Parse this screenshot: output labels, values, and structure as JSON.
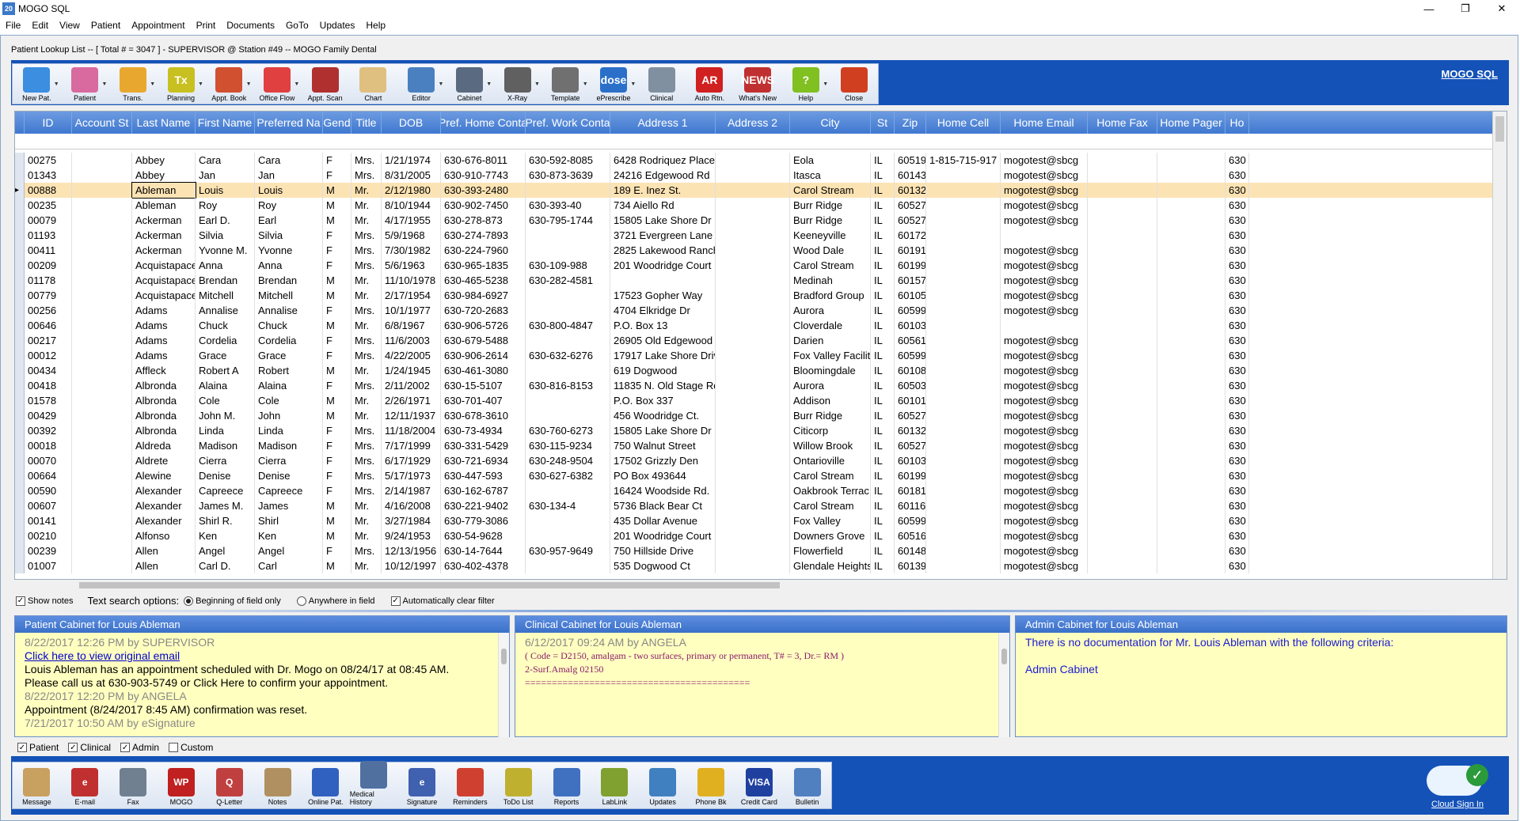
{
  "window": {
    "title": "MOGO SQL",
    "app_icon_text": "20",
    "minimize": "—",
    "maximize": "❐",
    "close": "✕"
  },
  "menu": [
    "File",
    "Edit",
    "View",
    "Patient",
    "Appointment",
    "Print",
    "Documents",
    "GoTo",
    "Updates",
    "Help"
  ],
  "subtitle": "Patient Lookup List -- [ Total # = 3047 ] - SUPERVISOR @ Station #49 -- MOGO Family Dental",
  "mogo_link": "MOGO SQL",
  "toolbar": [
    {
      "label": "New Pat.",
      "icon": "new-patient-icon",
      "color": "#3b8ee0"
    },
    {
      "label": "Patient",
      "icon": "patient-icon",
      "color": "#d86aa0"
    },
    {
      "label": "Trans.",
      "icon": "folder-icon",
      "color": "#e8a830"
    },
    {
      "label": "Planning",
      "icon": "tx-planning-icon",
      "color": "#c8c020",
      "text": "Tx"
    },
    {
      "label": "Appt. Book",
      "icon": "appointment-book-icon",
      "color": "#d05030"
    },
    {
      "label": "Office Flow",
      "icon": "office-flow-icon",
      "color": "#e04040"
    },
    {
      "label": "Appt. Scan",
      "icon": "appointment-scan-icon",
      "color": "#b03030"
    },
    {
      "label": "Chart",
      "icon": "tooth-chart-icon",
      "color": "#e0c080"
    },
    {
      "label": "Editor",
      "icon": "image-editor-icon",
      "color": "#4a80c0"
    },
    {
      "label": "Cabinet",
      "icon": "cabinet-icon",
      "color": "#5a6a80"
    },
    {
      "label": "X-Ray",
      "icon": "xray-icon",
      "color": "#606060"
    },
    {
      "label": "Template",
      "icon": "template-icon",
      "color": "#707070"
    },
    {
      "label": "ePrescribe",
      "icon": "dosespot-icon",
      "color": "#2a70c8",
      "text": "dose"
    },
    {
      "label": "Clinical",
      "icon": "clinical-icon",
      "color": "#8090a0"
    },
    {
      "label": "Auto Rtn.",
      "icon": "auto-return-icon",
      "color": "#d02020",
      "text": "AR"
    },
    {
      "label": "What's New",
      "icon": "news-icon",
      "color": "#c03030",
      "text": "NEWS"
    },
    {
      "label": "Help",
      "icon": "help-icon",
      "color": "#80c020",
      "text": "?"
    },
    {
      "label": "Close",
      "icon": "close-door-icon",
      "color": "#d04020"
    }
  ],
  "grid": {
    "columns": [
      "ID",
      "Account St",
      "Last Name",
      "First Name",
      "Preferred Na",
      "Gend",
      "Title",
      "DOB",
      "Pref. Home Conta",
      "Pref. Work Conta",
      "Address 1",
      "Address 2",
      "City",
      "St",
      "Zip",
      "Home Cell",
      "Home Email",
      "Home Fax",
      "Home Pager",
      "Ho"
    ],
    "rows": [
      [
        "00275",
        "",
        "Abbey",
        "Cara",
        "Cara",
        "F",
        "Mrs.",
        "1/21/1974",
        "630-676-8011",
        "630-592-8085",
        "6428 Rodriquez Place",
        "",
        "Eola",
        "IL",
        "60519",
        "1-815-715-917",
        "mogotest@sbcg",
        "",
        "",
        "630"
      ],
      [
        "01343",
        "",
        "Abbey",
        "Jan",
        "Jan",
        "F",
        "Mrs.",
        "8/31/2005",
        "630-910-7743",
        "630-873-3639",
        "24216 Edgewood Rd",
        "",
        "Itasca",
        "IL",
        "60143",
        "",
        "mogotest@sbcg",
        "",
        "",
        "630"
      ],
      [
        "00888",
        "",
        "Ableman",
        "Louis",
        "Louis",
        "M",
        "Mr.",
        "2/12/1980",
        "630-393-2480",
        "",
        "189 E. Inez St.",
        "",
        "Carol Stream",
        "IL",
        "60132",
        "",
        "mogotest@sbcg",
        "",
        "",
        "630"
      ],
      [
        "00235",
        "",
        "Ableman",
        "Roy",
        "Roy",
        "M",
        "Mr.",
        "8/10/1944",
        "630-902-7450",
        "630-393-40",
        "734 Aiello Rd",
        "",
        "Burr Ridge",
        "IL",
        "60527",
        "",
        "mogotest@sbcg",
        "",
        "",
        "630"
      ],
      [
        "00079",
        "",
        "Ackerman",
        "Earl D.",
        "Earl",
        "M",
        "Mr.",
        "4/17/1955",
        "630-278-873",
        "630-795-1744",
        "15805 Lake Shore Dr",
        "",
        "Burr Ridge",
        "IL",
        "60527",
        "",
        "mogotest@sbcg",
        "",
        "",
        "630"
      ],
      [
        "01193",
        "",
        "Ackerman",
        "Silvia",
        "Silvia",
        "F",
        "Mrs.",
        "5/9/1968",
        "630-274-7893",
        "",
        "3721 Evergreen Lane",
        "",
        "Keeneyville",
        "IL",
        "60172",
        "",
        "",
        "",
        "",
        "630"
      ],
      [
        "00411",
        "",
        "Ackerman",
        "Yvonne M.",
        "Yvonne",
        "F",
        "Mrs.",
        "7/30/1982",
        "630-224-7960",
        "",
        "2825 Lakewood Ranch",
        "",
        "Wood Dale",
        "IL",
        "60191",
        "",
        "mogotest@sbcg",
        "",
        "",
        "630"
      ],
      [
        "00209",
        "",
        "Acquistapace",
        "Anna",
        "Anna",
        "F",
        "Mrs.",
        "5/6/1963",
        "630-965-1835",
        "630-109-988",
        "201 Woodridge Court",
        "",
        "Carol Stream",
        "IL",
        "60199",
        "",
        "mogotest@sbcg",
        "",
        "",
        "630"
      ],
      [
        "01178",
        "",
        "Acquistapace",
        "Brendan",
        "Brendan",
        "M",
        "Mr.",
        "11/10/1978",
        "630-465-5238",
        "630-282-4581",
        "",
        "",
        "Medinah",
        "IL",
        "60157",
        "",
        "mogotest@sbcg",
        "",
        "",
        "630"
      ],
      [
        "00779",
        "",
        "Acquistapace",
        "Mitchell",
        "Mitchell",
        "M",
        "Mr.",
        "2/17/1954",
        "630-984-6927",
        "",
        "17523 Gopher Way",
        "",
        "Bradford Group",
        "IL",
        "60105",
        "",
        "mogotest@sbcg",
        "",
        "",
        "630"
      ],
      [
        "00256",
        "",
        "Adams",
        "Annalise",
        "Annalise",
        "F",
        "Mrs.",
        "10/1/1977",
        "630-720-2683",
        "",
        "4704 Elkridge Dr",
        "",
        "Aurora",
        "IL",
        "60599",
        "",
        "mogotest@sbcg",
        "",
        "",
        "630"
      ],
      [
        "00646",
        "",
        "Adams",
        "Chuck",
        "Chuck",
        "M",
        "Mr.",
        "6/8/1967",
        "630-906-5726",
        "630-800-4847",
        "P.O. Box 13",
        "",
        "Cloverdale",
        "IL",
        "60103",
        "",
        "",
        "",
        "",
        "630"
      ],
      [
        "00217",
        "",
        "Adams",
        "Cordelia",
        "Cordelia",
        "F",
        "Mrs.",
        "11/6/2003",
        "630-679-5488",
        "",
        "26905 Old Edgewood R",
        "",
        "Darien",
        "IL",
        "60561",
        "",
        "mogotest@sbcg",
        "",
        "",
        "630"
      ],
      [
        "00012",
        "",
        "Adams",
        "Grace",
        "Grace",
        "F",
        "Mrs.",
        "4/22/2005",
        "630-906-2614",
        "630-632-6276",
        "17917 Lake Shore Driv",
        "",
        "Fox Valley Facilit",
        "IL",
        "60599",
        "",
        "mogotest@sbcg",
        "",
        "",
        "630"
      ],
      [
        "00434",
        "",
        "Affleck",
        "Robert A",
        "Robert",
        "M",
        "Mr.",
        "1/24/1945",
        "630-461-3080",
        "",
        "619 Dogwood",
        "",
        "Bloomingdale",
        "IL",
        "60108",
        "",
        "mogotest@sbcg",
        "",
        "",
        "630"
      ],
      [
        "00418",
        "",
        "Albronda",
        "Alaina",
        "Alaina",
        "F",
        "Mrs.",
        "2/11/2002",
        "630-15-5107",
        "630-816-8153",
        "11835 N. Old Stage Rd",
        "",
        "Aurora",
        "IL",
        "60503",
        "",
        "mogotest@sbcg",
        "",
        "",
        "630"
      ],
      [
        "01578",
        "",
        "Albronda",
        "Cole",
        "Cole",
        "M",
        "Mr.",
        "2/26/1971",
        "630-701-407",
        "",
        "P.O. Box 337",
        "",
        "Addison",
        "IL",
        "60101",
        "",
        "mogotest@sbcg",
        "",
        "",
        "630"
      ],
      [
        "00429",
        "",
        "Albronda",
        "John M.",
        "John",
        "M",
        "Mr.",
        "12/11/1937",
        "630-678-3610",
        "",
        "456 Woodridge Ct.",
        "",
        "Burr Ridge",
        "IL",
        "60527",
        "",
        "mogotest@sbcg",
        "",
        "",
        "630"
      ],
      [
        "00392",
        "",
        "Albronda",
        "Linda",
        "Linda",
        "F",
        "Mrs.",
        "11/18/2004",
        "630-73-4934",
        "630-760-6273",
        "15805 Lake Shore Dr",
        "",
        "Citicorp",
        "IL",
        "60132",
        "",
        "mogotest@sbcg",
        "",
        "",
        "630"
      ],
      [
        "00018",
        "",
        "Aldreda",
        "Madison",
        "Madison",
        "F",
        "Mrs.",
        "7/17/1999",
        "630-331-5429",
        "630-115-9234",
        "750 Walnut Street",
        "",
        "Willow Brook",
        "IL",
        "60527",
        "",
        "mogotest@sbcg",
        "",
        "",
        "630"
      ],
      [
        "00070",
        "",
        "Aldrete",
        "Cierra",
        "Cierra",
        "F",
        "Mrs.",
        "6/17/1929",
        "630-721-6934",
        "630-248-9504",
        "17502 Grizzly Den",
        "",
        "Ontarioville",
        "IL",
        "60103",
        "",
        "mogotest@sbcg",
        "",
        "",
        "630"
      ],
      [
        "00664",
        "",
        "Alewine",
        "Denise",
        "Denise",
        "F",
        "Mrs.",
        "5/17/1973",
        "630-447-593",
        "630-627-6382",
        "PO Box 493644",
        "",
        "Carol Stream",
        "IL",
        "60199",
        "",
        "mogotest@sbcg",
        "",
        "",
        "630"
      ],
      [
        "00590",
        "",
        "Alexander",
        "Capreece",
        "Capreece",
        "F",
        "Mrs.",
        "2/14/1987",
        "630-162-6787",
        "",
        "16424 Woodside Rd.",
        "",
        "Oakbrook Terrac",
        "IL",
        "60181",
        "",
        "mogotest@sbcg",
        "",
        "",
        "630"
      ],
      [
        "00607",
        "",
        "Alexander",
        "James M.",
        "James",
        "M",
        "Mr.",
        "4/16/2008",
        "630-221-9402",
        "630-134-4",
        "5736 Black Bear Ct",
        "",
        "Carol Stream",
        "IL",
        "60116",
        "",
        "mogotest@sbcg",
        "",
        "",
        "630"
      ],
      [
        "00141",
        "",
        "Alexander",
        "Shirl R.",
        "Shirl",
        "M",
        "Mr.",
        "3/27/1984",
        "630-779-3086",
        "",
        "435 Dollar Avenue",
        "",
        "Fox Valley",
        "IL",
        "60599",
        "",
        "mogotest@sbcg",
        "",
        "",
        "630"
      ],
      [
        "00210",
        "",
        "Alfonso",
        "Ken",
        "Ken",
        "M",
        "Mr.",
        "9/24/1953",
        "630-54-9628",
        "",
        "201 Woodridge Court",
        "",
        "Downers Grove",
        "IL",
        "60516",
        "",
        "mogotest@sbcg",
        "",
        "",
        "630"
      ],
      [
        "00239",
        "",
        "Allen",
        "Angel",
        "Angel",
        "F",
        "Mrs.",
        "12/13/1956",
        "630-14-7644",
        "630-957-9649",
        "750 Hillside Drive",
        "",
        "Flowerfield",
        "IL",
        "60148",
        "",
        "mogotest@sbcg",
        "",
        "",
        "630"
      ],
      [
        "01007",
        "",
        "Allen",
        "Carl D.",
        "Carl",
        "M",
        "Mr.",
        "10/12/1997",
        "630-402-4378",
        "",
        "535 Dogwood Ct",
        "",
        "Glendale Heights",
        "IL",
        "60139",
        "",
        "mogotest@sbcg",
        "",
        "",
        "630"
      ]
    ],
    "selected_row": 2
  },
  "options": {
    "show_notes": "Show notes",
    "text_search_label": "Text search options:",
    "beginning_of_field": "Beginning of field only",
    "anywhere_in_field": "Anywhere in field",
    "auto_clear": "Automatically clear filter"
  },
  "patient_cabinet": {
    "title": "Patient Cabinet for Louis Ableman",
    "entry1_meta": "8/22/2017 12:26 PM by SUPERVISOR",
    "entry1_link": "Click here to view original email",
    "entry1_text1": "Louis Ableman has an appointment scheduled with Dr. Mogo on 08/24/17 at 08:45 AM.",
    "entry1_text2": "Please call us at 630-903-5749 or Click Here to confirm your appointment.",
    "entry2_meta": "8/22/2017 12:20 PM by ANGELA",
    "entry2_text": "Appointment (8/24/2017 8:45 AM) confirmation was reset.",
    "entry3_meta": "7/21/2017 10:50 AM by eSignature"
  },
  "clinical_cabinet": {
    "title": "Clinical Cabinet for Louis Ableman",
    "meta": "6/12/2017 09:24 AM by ANGELA",
    "code": "( Code = D2150, amalgam - two surfaces, primary or permanent, T# = 3, Dr.= RM )",
    "detail": "2-Surf.Amalg  02150",
    "rule": "=========================================="
  },
  "admin_cabinet": {
    "title": "Admin Cabinet for Louis Ableman",
    "msg": "There is no documentation for Mr. Louis Ableman with the following criteria:",
    "criteria": "Admin Cabinet"
  },
  "cabinet_filters": [
    "Patient",
    "Clinical",
    "Admin",
    "Custom"
  ],
  "bottom_toolbar": [
    {
      "label": "Message",
      "icon": "message-icon",
      "color": "#c8a060"
    },
    {
      "label": "E-mail",
      "icon": "email-icon",
      "color": "#c03030",
      "text": "e"
    },
    {
      "label": "Fax",
      "icon": "fax-icon",
      "color": "#708090"
    },
    {
      "label": "MOGO",
      "icon": "mogo-wp-icon",
      "color": "#c02020",
      "text": "WP"
    },
    {
      "label": "Q-Letter",
      "icon": "q-letter-icon",
      "color": "#c04040",
      "text": "Q"
    },
    {
      "label": "Notes",
      "icon": "notes-icon",
      "color": "#b09060"
    },
    {
      "label": "Online Pat.",
      "icon": "online-patient-icon",
      "color": "#3060c0"
    },
    {
      "label": "Medical History",
      "icon": "medical-history-icon",
      "color": "#5070a0"
    },
    {
      "label": "Signature",
      "icon": "signature-icon",
      "color": "#4060b0",
      "text": "e"
    },
    {
      "label": "Reminders",
      "icon": "reminders-icon",
      "color": "#d04030"
    },
    {
      "label": "ToDo List",
      "icon": "todo-list-icon",
      "color": "#c0b030"
    },
    {
      "label": "Reports",
      "icon": "reports-icon",
      "color": "#4070c0"
    },
    {
      "label": "LabLink",
      "icon": "lablink-icon",
      "color": "#80a030"
    },
    {
      "label": "Updates",
      "icon": "updates-icon",
      "color": "#4080c0"
    },
    {
      "label": "Phone Bk",
      "icon": "phone-book-icon",
      "color": "#e0b020"
    },
    {
      "label": "Credit Card",
      "icon": "credit-card-icon",
      "color": "#2040a0",
      "text": "VISA"
    },
    {
      "label": "Bulletin",
      "icon": "bulletin-icon",
      "color": "#5080c0"
    }
  ],
  "cloud": {
    "label": "Cloud Sign In"
  }
}
